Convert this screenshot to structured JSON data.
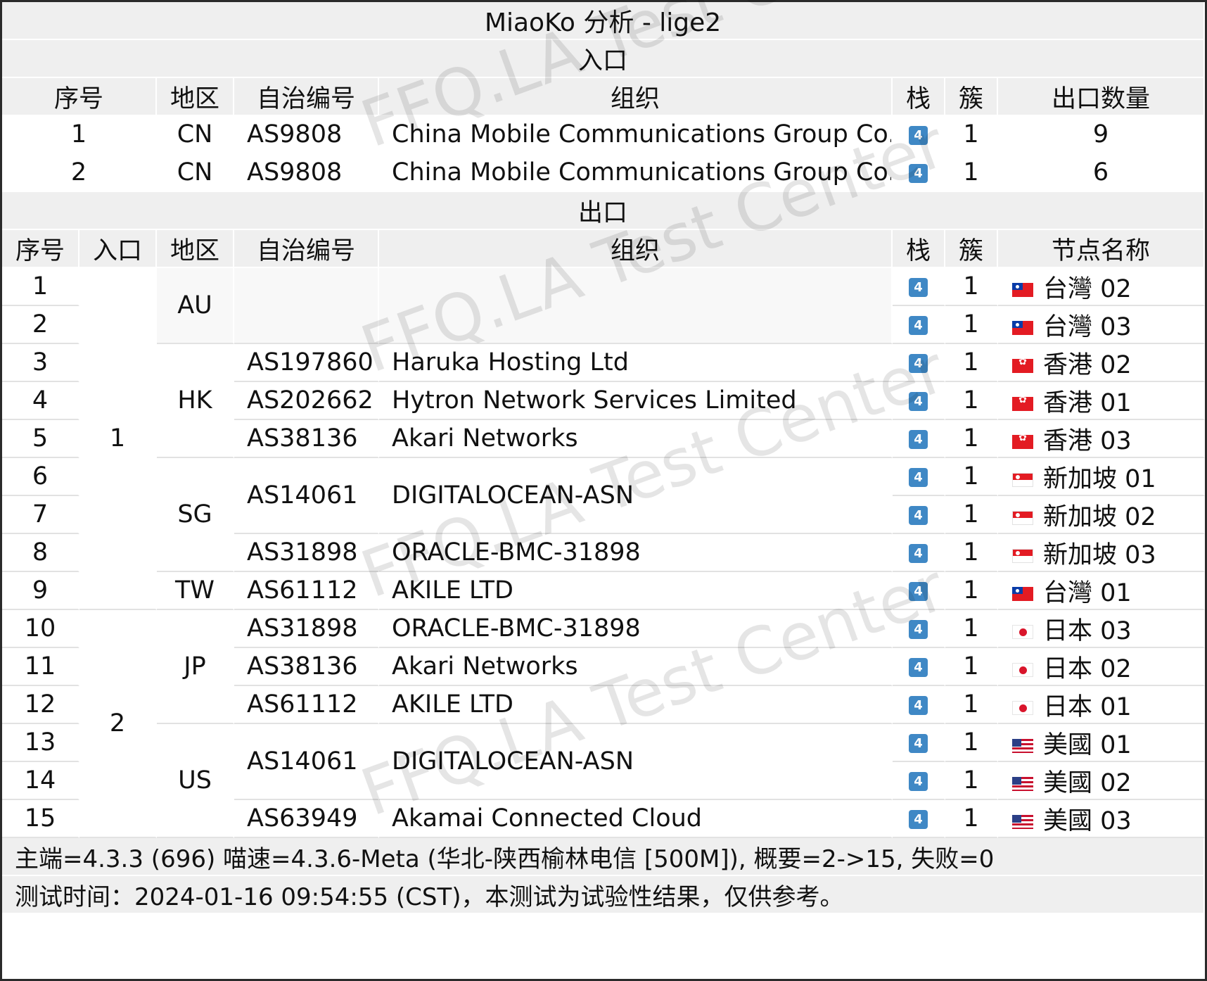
{
  "title": "MiaoKo 分析 - lige2",
  "entry_section": {
    "label": "入口",
    "headers": [
      "序号",
      "地区",
      "自治编号",
      "组织",
      "栈",
      "簇",
      "出口数量"
    ],
    "rows": [
      {
        "index": "1",
        "region": "CN",
        "asn": "AS9808",
        "org": "China Mobile Communications Group Co., Ltd.",
        "stack": "4",
        "cluster": "1",
        "exit_count": "9"
      },
      {
        "index": "2",
        "region": "CN",
        "asn": "AS9808",
        "org": "China Mobile Communications Group Co., Ltd.",
        "stack": "4",
        "cluster": "1",
        "exit_count": "6"
      }
    ]
  },
  "exit_section": {
    "label": "出口",
    "headers": [
      "序号",
      "入口",
      "地区",
      "自治编号",
      "组织",
      "栈",
      "簇",
      "节点名称"
    ],
    "entries": [
      "1",
      "2"
    ],
    "regions": [
      "AU",
      "HK",
      "SG",
      "TW",
      "JP",
      "US"
    ],
    "asn_groups": [
      {
        "asn": "",
        "org": ""
      },
      {
        "asn": "AS197860",
        "org": "Haruka Hosting Ltd"
      },
      {
        "asn": "AS202662",
        "org": "Hytron Network Services Limited"
      },
      {
        "asn": "AS38136",
        "org": "Akari Networks"
      },
      {
        "asn": "AS14061",
        "org": "DIGITALOCEAN-ASN"
      },
      {
        "asn": "AS31898",
        "org": "ORACLE-BMC-31898"
      },
      {
        "asn": "AS61112",
        "org": "AKILE LTD"
      },
      {
        "asn": "AS31898",
        "org": "ORACLE-BMC-31898"
      },
      {
        "asn": "AS38136",
        "org": "Akari Networks"
      },
      {
        "asn": "AS61112",
        "org": "AKILE LTD"
      },
      {
        "asn": "AS14061",
        "org": "DIGITALOCEAN-ASN"
      },
      {
        "asn": "AS63949",
        "org": "Akamai Connected Cloud"
      }
    ],
    "rows": [
      {
        "index": "1",
        "stack": "4",
        "cluster": "1",
        "flag": "flag-tw",
        "node": "台灣 02"
      },
      {
        "index": "2",
        "stack": "4",
        "cluster": "1",
        "flag": "flag-tw",
        "node": "台灣 03"
      },
      {
        "index": "3",
        "stack": "4",
        "cluster": "1",
        "flag": "flag-hk",
        "node": "香港 02"
      },
      {
        "index": "4",
        "stack": "4",
        "cluster": "1",
        "flag": "flag-hk",
        "node": "香港 01"
      },
      {
        "index": "5",
        "stack": "4",
        "cluster": "1",
        "flag": "flag-hk",
        "node": "香港 03"
      },
      {
        "index": "6",
        "stack": "4",
        "cluster": "1",
        "flag": "flag-sg",
        "node": "新加坡 01"
      },
      {
        "index": "7",
        "stack": "4",
        "cluster": "1",
        "flag": "flag-sg",
        "node": "新加坡 02"
      },
      {
        "index": "8",
        "stack": "4",
        "cluster": "1",
        "flag": "flag-sg",
        "node": "新加坡 03"
      },
      {
        "index": "9",
        "stack": "4",
        "cluster": "1",
        "flag": "flag-tw",
        "node": "台灣 01"
      },
      {
        "index": "10",
        "stack": "4",
        "cluster": "1",
        "flag": "flag-jp",
        "node": "日本 03"
      },
      {
        "index": "11",
        "stack": "4",
        "cluster": "1",
        "flag": "flag-jp",
        "node": "日本 02"
      },
      {
        "index": "12",
        "stack": "4",
        "cluster": "1",
        "flag": "flag-jp",
        "node": "日本 01"
      },
      {
        "index": "13",
        "stack": "4",
        "cluster": "1",
        "flag": "flag-us",
        "node": "美國 01"
      },
      {
        "index": "14",
        "stack": "4",
        "cluster": "1",
        "flag": "flag-us",
        "node": "美國 02"
      },
      {
        "index": "15",
        "stack": "4",
        "cluster": "1",
        "flag": "flag-us",
        "node": "美國 03"
      }
    ]
  },
  "footer": {
    "line1": "主端=4.3.3 (696) 喵速=4.3.6-Meta (华北-陕西榆林电信 [500M]), 概要=2->15, 失败=0",
    "line2": "测试时间：2024-01-16 09:54:55 (CST)，本测试为试验性结果，仅供参考。"
  },
  "watermark": "FFQ.LA Test Center"
}
